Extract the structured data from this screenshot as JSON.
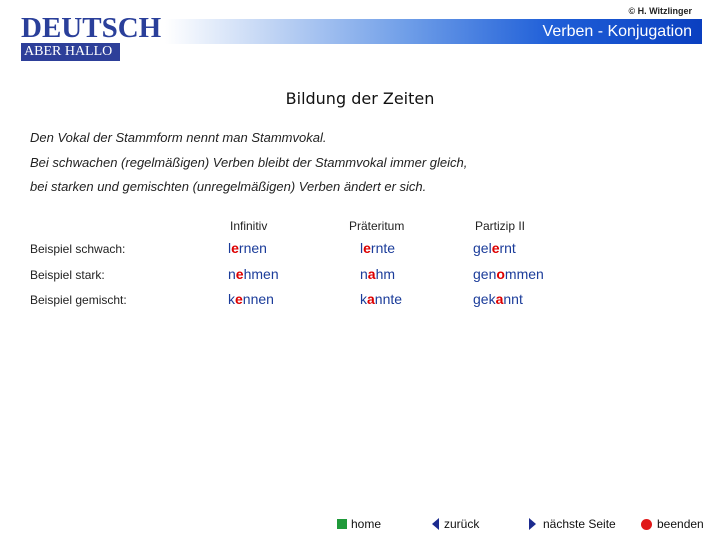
{
  "copyright": "© H. Witzlinger",
  "logo": {
    "line1": "DEUTSCH",
    "line2": "ABER HALLO"
  },
  "header": {
    "title": "Verben - Konjugation"
  },
  "page_title": "Bildung der Zeiten",
  "paragraphs": [
    "Den Vokal der Stammform nennt man Stammvokal.",
    "Bei schwachen (regelmäßigen) Verben bleibt der Stammvokal immer gleich,",
    "bei starken und gemischten (unregelmäßigen) Verben ändert er sich."
  ],
  "table": {
    "columns": [
      "Infinitiv",
      "Präteritum",
      "Partizip II"
    ],
    "rows": [
      {
        "label": "Beispiel schwach:",
        "cells": [
          {
            "pre": "l",
            "vowel": "e",
            "post": "rnen"
          },
          {
            "pre": "l",
            "vowel": "e",
            "post": "rnte"
          },
          {
            "pre": "gel",
            "vowel": "e",
            "post": "rnt"
          }
        ]
      },
      {
        "label": "Beispiel stark:",
        "cells": [
          {
            "pre": "n",
            "vowel": "e",
            "post": "hmen"
          },
          {
            "pre": "n",
            "vowel": "a",
            "post": "hm"
          },
          {
            "pre": "gen",
            "vowel": "o",
            "post": "mmen"
          }
        ]
      },
      {
        "label": "Beispiel gemischt:",
        "cells": [
          {
            "pre": "k",
            "vowel": "e",
            "post": "nnen"
          },
          {
            "pre": "k",
            "vowel": "a",
            "post": "nnte"
          },
          {
            "pre": "gek",
            "vowel": "a",
            "post": "nnt"
          }
        ]
      }
    ]
  },
  "nav": {
    "home": "home",
    "back": "zurück",
    "next": "nächste Seite",
    "quit": "beenden"
  },
  "colors": {
    "vowel_highlight": "#dd0000",
    "verb_text": "#1b3c9a",
    "home_icon": "#1f9a3a",
    "quit_icon": "#e01818"
  }
}
